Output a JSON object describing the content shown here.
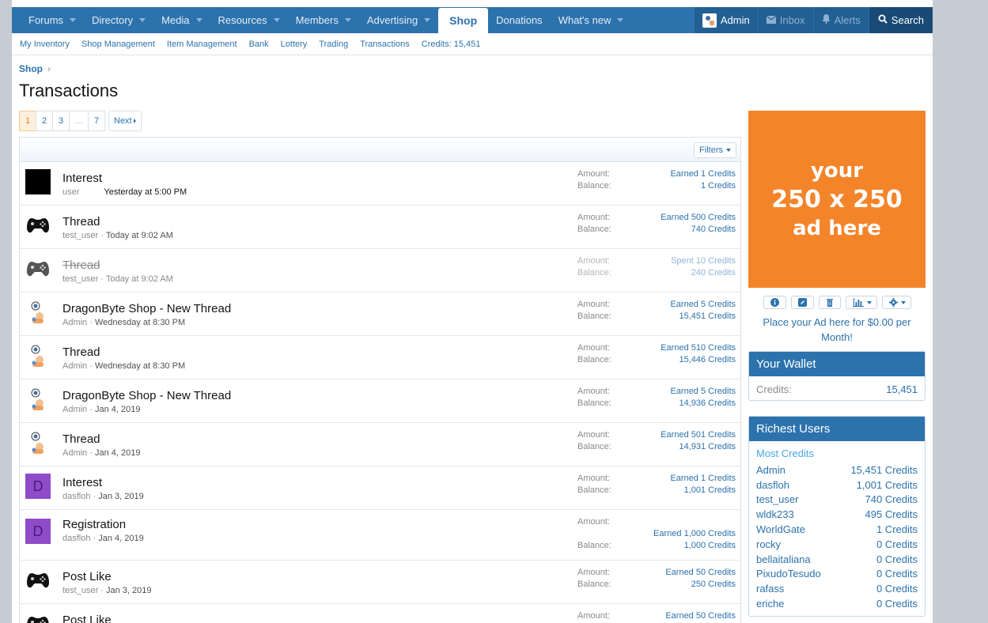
{
  "nav": {
    "items": [
      {
        "label": "Forums",
        "caret": true
      },
      {
        "label": "Directory",
        "caret": true
      },
      {
        "label": "Media",
        "caret": true
      },
      {
        "label": "Resources",
        "caret": true
      },
      {
        "label": "Members",
        "caret": true
      },
      {
        "label": "Advertising",
        "caret": true
      },
      {
        "label": "Shop",
        "caret": false,
        "active": true
      },
      {
        "label": "Donations",
        "caret": false
      },
      {
        "label": "What's new",
        "caret": true
      }
    ],
    "admin_label": "Admin",
    "inbox_label": "Inbox",
    "alerts_label": "Alerts",
    "search_label": "Search"
  },
  "subnav": [
    "My Inventory",
    "Shop Management",
    "Item Management",
    "Bank",
    "Lottery",
    "Trading",
    "Transactions",
    "Credits: 15,451"
  ],
  "breadcrumb": {
    "label": "Shop",
    "sep": "›"
  },
  "page_title": "Transactions",
  "pager": {
    "pages": [
      "1",
      "2",
      "3",
      "…",
      "7"
    ],
    "current": "1",
    "next_label": "Next"
  },
  "filters_label": "Filters",
  "amount_label": "Amount:",
  "balance_label": "Balance:",
  "transactions": [
    {
      "title": "Interest",
      "user": "user",
      "sep": "",
      "when": "Yesterday at 5:00 PM",
      "amount": "Earned 1 Credits",
      "balance": "1 Credits",
      "avatar": "black"
    },
    {
      "title": "Thread",
      "user": "test_user",
      "sep": " · ",
      "when": "Today at 9:02 AM",
      "amount": "Earned 500 Credits",
      "balance": "740 Credits",
      "avatar": "gamepad"
    },
    {
      "title": "Thread",
      "user": "test_user",
      "sep": " · ",
      "when": "Today at 9:02 AM",
      "amount": "Spent 10 Credits",
      "balance": "240 Credits",
      "avatar": "gamepad-dim",
      "struck": true
    },
    {
      "title": "DragonByte Shop - New Thread",
      "user": "Admin",
      "sep": " · ",
      "when": "Wednesday at 8:30 PM",
      "amount": "Earned 5 Credits",
      "balance": "15,451 Credits",
      "avatar": "admin"
    },
    {
      "title": "Thread",
      "user": "Admin",
      "sep": " · ",
      "when": "Wednesday at 8:30 PM",
      "amount": "Earned 510 Credits",
      "balance": "15,446 Credits",
      "avatar": "admin"
    },
    {
      "title": "DragonByte Shop - New Thread",
      "user": "Admin",
      "sep": " · ",
      "when": "Jan 4, 2019",
      "amount": "Earned 5 Credits",
      "balance": "14,936 Credits",
      "avatar": "admin"
    },
    {
      "title": "Thread",
      "user": "Admin",
      "sep": " · ",
      "when": "Jan 4, 2019",
      "amount": "Earned 501 Credits",
      "balance": "14,931 Credits",
      "avatar": "admin"
    },
    {
      "title": "Interest",
      "user": "dasfloh",
      "sep": " · ",
      "when": "Jan 3, 2019",
      "amount": "Earned 1 Credits",
      "balance": "1,001 Credits",
      "avatar": "D"
    },
    {
      "title": "Registration",
      "user": "dasfloh",
      "sep": " · ",
      "when": "Jan 4, 2019",
      "amount": "Earned 1,000 Credits",
      "balance": "1,000 Credits",
      "avatar": "D",
      "tall": true
    },
    {
      "title": "Post Like",
      "user": "test_user",
      "sep": " · ",
      "when": "Jan 3, 2019",
      "amount": "Earned 50 Credits",
      "balance": "250 Credits",
      "avatar": "gamepad"
    },
    {
      "title": "Post Like",
      "user": "",
      "sep": "",
      "when": "",
      "amount": "Earned 50 Credits",
      "balance": "",
      "avatar": "gamepad"
    }
  ],
  "ad": {
    "line1": "your",
    "line2": "250 x 250",
    "line3": "ad here",
    "link": "Place your Ad here for $0.00 per Month!",
    "color": "#f4842a"
  },
  "wallet": {
    "title": "Your Wallet",
    "label": "Credits:",
    "value": "15,451"
  },
  "richest": {
    "title": "Richest Users",
    "subtitle": "Most Credits",
    "users": [
      {
        "name": "Admin",
        "credits": "15,451 Credits"
      },
      {
        "name": "dasfloh",
        "credits": "1,001 Credits"
      },
      {
        "name": "test_user",
        "credits": "740 Credits"
      },
      {
        "name": "wldk233",
        "credits": "495 Credits"
      },
      {
        "name": "WorldGate",
        "credits": "1 Credits"
      },
      {
        "name": "rocky",
        "credits": "0 Credits"
      },
      {
        "name": "bellaitaliana",
        "credits": "0 Credits"
      },
      {
        "name": "PixudoTesudo",
        "credits": "0 Credits"
      },
      {
        "name": "rafass",
        "credits": "0 Credits"
      },
      {
        "name": "eriche",
        "credits": "0 Credits"
      }
    ]
  },
  "colors": {
    "brand": "#2c72ad",
    "accent": "#f4842a",
    "link": "#2c72ad"
  }
}
